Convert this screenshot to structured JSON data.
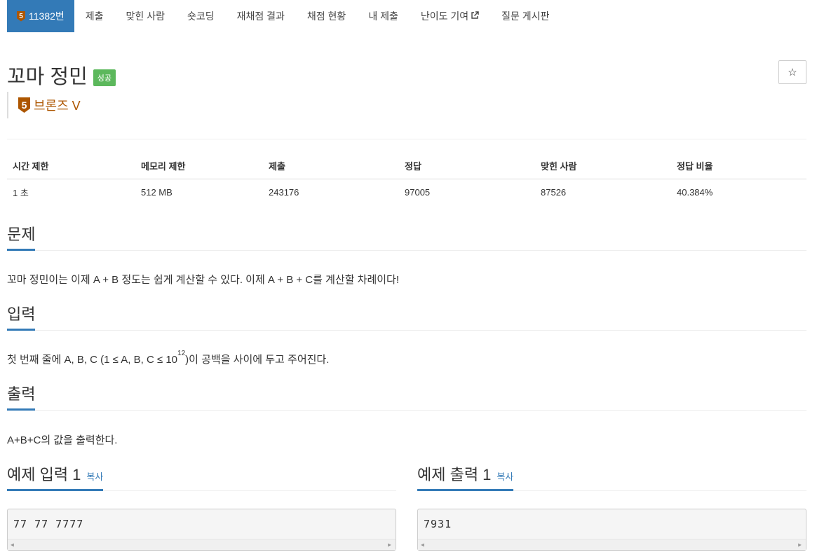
{
  "nav": {
    "active": {
      "tier_digit": "5",
      "label": "11382번"
    },
    "items": [
      "제출",
      "맞힌 사람",
      "숏코딩",
      "재채점 결과",
      "채점 현황",
      "내 제출",
      "난이도 기여",
      "질문 게시판"
    ],
    "external_icon": "external-link-icon"
  },
  "problem": {
    "title": "꼬마 정민",
    "status": "성공",
    "star_icon": "☆",
    "tier_digit": "5",
    "tier_name": "브론즈 V"
  },
  "stats": {
    "headers": [
      "시간 제한",
      "메모리 제한",
      "제출",
      "정답",
      "맞힌 사람",
      "정답 비율"
    ],
    "values": [
      "1 초",
      "512 MB",
      "243176",
      "97005",
      "87526",
      "40.384%"
    ]
  },
  "sections": {
    "problem": {
      "title": "문제",
      "text": "꼬마 정민이는 이제 A + B 정도는 쉽게 계산할 수 있다. 이제 A + B + C를 계산할 차례이다!"
    },
    "input": {
      "title": "입력",
      "text_before": "첫 번째 줄에 A, B, C (1 ≤ A, B, C ≤ 10",
      "sup": "12",
      "text_after": ")이 공백을 사이에 두고 주어진다."
    },
    "output": {
      "title": "출력",
      "text": "A+B+C의 값을 출력한다."
    }
  },
  "samples": {
    "input": {
      "title": "예제 입력 1",
      "copy": "복사",
      "content": "77 77 7777"
    },
    "output": {
      "title": "예제 출력 1",
      "copy": "복사",
      "content": "7931"
    }
  },
  "colors": {
    "primary": "#337ab7",
    "success": "#5cb85c",
    "bronze": "#ad5600"
  }
}
